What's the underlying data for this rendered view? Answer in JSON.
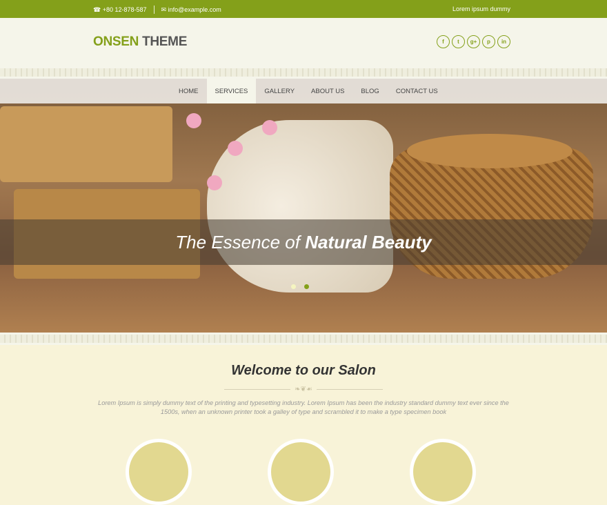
{
  "topbar": {
    "phone": "+80 12-878-587",
    "email": "info@example.com",
    "right_text": "Lorem ipsum dummy",
    "phone_icon": "☎",
    "email_icon": "✉"
  },
  "header": {
    "logo_part1": "ONSEN",
    "logo_part2": "THEME",
    "social": [
      "f",
      "t",
      "g+",
      "p",
      "in"
    ]
  },
  "nav": {
    "items": [
      "HOME",
      "SERVICES",
      "GALLERY",
      "ABOUT US",
      "BLOG",
      "CONTACT US"
    ],
    "active": "SERVICES"
  },
  "hero": {
    "caption_light": "The Essence of",
    "caption_bold": "Natural Beauty",
    "slides": 2,
    "active_slide": 1
  },
  "welcome": {
    "title": "Welcome to our Salon",
    "ornament": "❧❦☙",
    "text": "Lorem Ipsum is simply dummy text of the printing and typesetting industry. Lorem Ipsum has been the industry standard dummy text ever since the 1500s, when an unknown printer took a galley of type and scrambled it to make a type specimen book"
  },
  "colors": {
    "accent": "#84a01a",
    "background": "#f8f3d8",
    "header": "#f5f5ea"
  }
}
